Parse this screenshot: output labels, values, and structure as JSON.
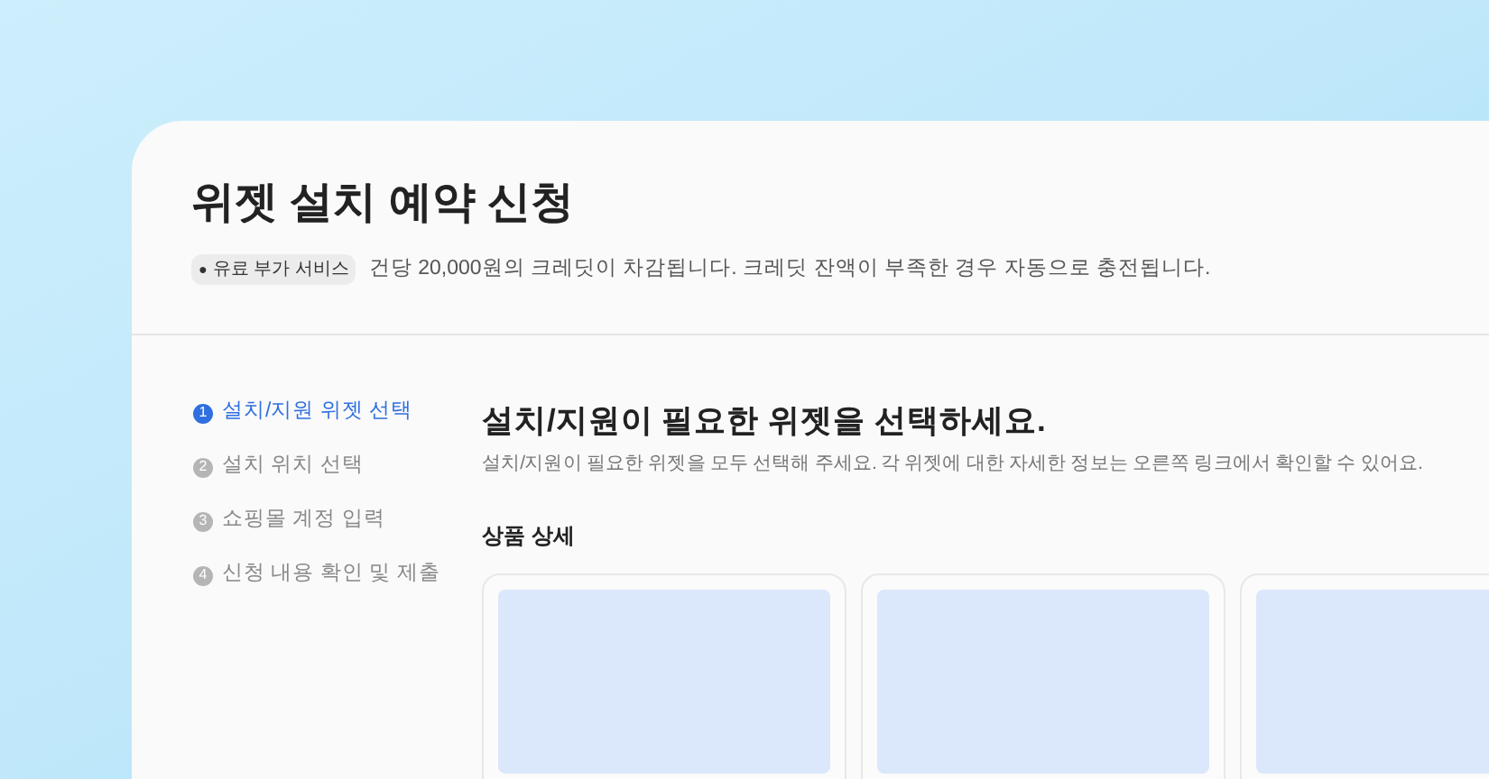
{
  "page": {
    "title": "위젯 설치 예약 신청",
    "badge": {
      "icon": "●",
      "label": "유료 부가 서비스"
    },
    "notice": "건당 20,000원의 크레딧이 차감됩니다. 크레딧 잔액이 부족한 경우 자동으로 충전됩니다."
  },
  "steps": [
    {
      "number": "1",
      "label": "설치/지원 위젯 선택",
      "selected": true
    },
    {
      "number": "2",
      "label": "설치 위치 선택",
      "selected": false
    },
    {
      "number": "3",
      "label": "쇼핑몰 계정 입력",
      "selected": false
    },
    {
      "number": "4",
      "label": "신청 내용 확인 및 제출",
      "selected": false
    }
  ],
  "content": {
    "heading": "설치/지원이 필요한 위젯을 선택하세요.",
    "description": "설치/지원이 필요한 위젯을 모두 선택해 주세요. 각 위젯에 대한 자세한 정보는 오른쪽 링크에서 확인할 수 있어요.",
    "section_title": "상품 상세",
    "product_cards": [
      {
        "kind": "placeholder"
      },
      {
        "kind": "placeholder"
      },
      {
        "kind": "placeholder"
      }
    ]
  }
}
